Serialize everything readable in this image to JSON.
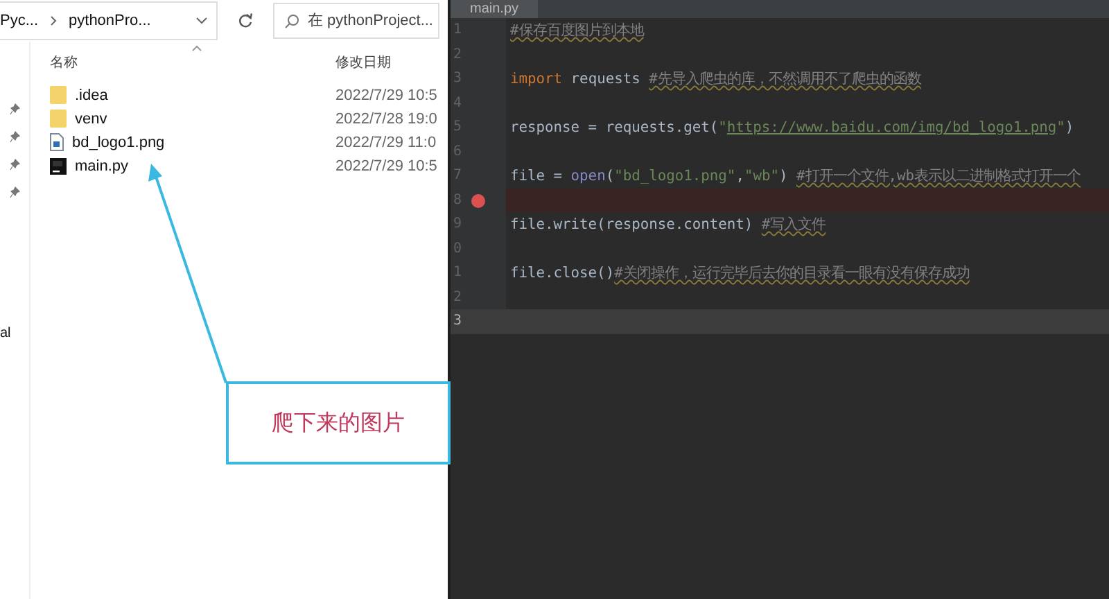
{
  "explorer": {
    "breadcrumbs": [
      "Pyc...",
      "pythonPro..."
    ],
    "search": {
      "placeholder": "在 pythonProject..."
    },
    "columns": [
      "名称",
      "修改日期"
    ],
    "nav_label": "al",
    "files": [
      {
        "name": ".idea",
        "kind": "folder",
        "modified": "2022/7/29 10:5"
      },
      {
        "name": "venv",
        "kind": "folder",
        "modified": "2022/7/28 19:0"
      },
      {
        "name": "bd_logo1.png",
        "kind": "image",
        "modified": "2022/7/29 11:0"
      },
      {
        "name": "main.py",
        "kind": "python",
        "modified": "2022/7/29 10:5"
      }
    ]
  },
  "annotation": {
    "text": "爬下来的图片"
  },
  "editor": {
    "tab": "main.py",
    "lines": [
      {
        "number": "1",
        "breakpoint": false,
        "current": false,
        "tokens": [
          {
            "kind": "comment",
            "text": "#保存百度图片到本地"
          }
        ]
      },
      {
        "number": "2",
        "breakpoint": false,
        "current": false
      },
      {
        "number": "3",
        "breakpoint": false,
        "current": false,
        "tokens": [
          {
            "kind": "keyword",
            "text": "import"
          },
          {
            "kind": "plain",
            "text": " requests "
          },
          {
            "kind": "comment",
            "text": "#先导入爬虫的库，不然调用不了爬虫的函数"
          }
        ]
      },
      {
        "number": "4",
        "breakpoint": false,
        "current": false
      },
      {
        "number": "5",
        "breakpoint": false,
        "current": false,
        "tokens": [
          {
            "kind": "plain",
            "text": "response = requests.get("
          },
          {
            "kind": "string",
            "text": "\""
          },
          {
            "kind": "url",
            "text": "https://www.baidu.com/img/bd_logo1.png"
          },
          {
            "kind": "string",
            "text": "\""
          },
          {
            "kind": "plain",
            "text": ")"
          }
        ]
      },
      {
        "number": "6",
        "breakpoint": false,
        "current": false
      },
      {
        "number": "7",
        "breakpoint": false,
        "current": false,
        "tokens": [
          {
            "kind": "plain",
            "text": "file = "
          },
          {
            "kind": "builtin",
            "text": "open"
          },
          {
            "kind": "plain",
            "text": "("
          },
          {
            "kind": "string",
            "text": "\"bd_logo1.png\""
          },
          {
            "kind": "plain",
            "text": ","
          },
          {
            "kind": "string",
            "text": "\"wb\""
          },
          {
            "kind": "plain",
            "text": ") "
          },
          {
            "kind": "comment",
            "text": "#打开一个文件,wb表示以二进制格式打开一个"
          }
        ]
      },
      {
        "number": "8",
        "breakpoint": true,
        "current": false
      },
      {
        "number": "9",
        "breakpoint": false,
        "current": false,
        "tokens": [
          {
            "kind": "plain",
            "text": "file.write(response.content) "
          },
          {
            "kind": "comment",
            "text": "#写入文件"
          }
        ]
      },
      {
        "number": "0",
        "breakpoint": false,
        "current": false
      },
      {
        "number": "1",
        "breakpoint": false,
        "current": false,
        "tokens": [
          {
            "kind": "plain",
            "text": "file.close()"
          },
          {
            "kind": "comment",
            "text": "#关闭操作，运行完毕后去你的目录看一眼有没有保存成功"
          }
        ]
      },
      {
        "number": "2",
        "breakpoint": false,
        "current": false
      },
      {
        "number": "3",
        "breakpoint": false,
        "current": true
      }
    ]
  }
}
